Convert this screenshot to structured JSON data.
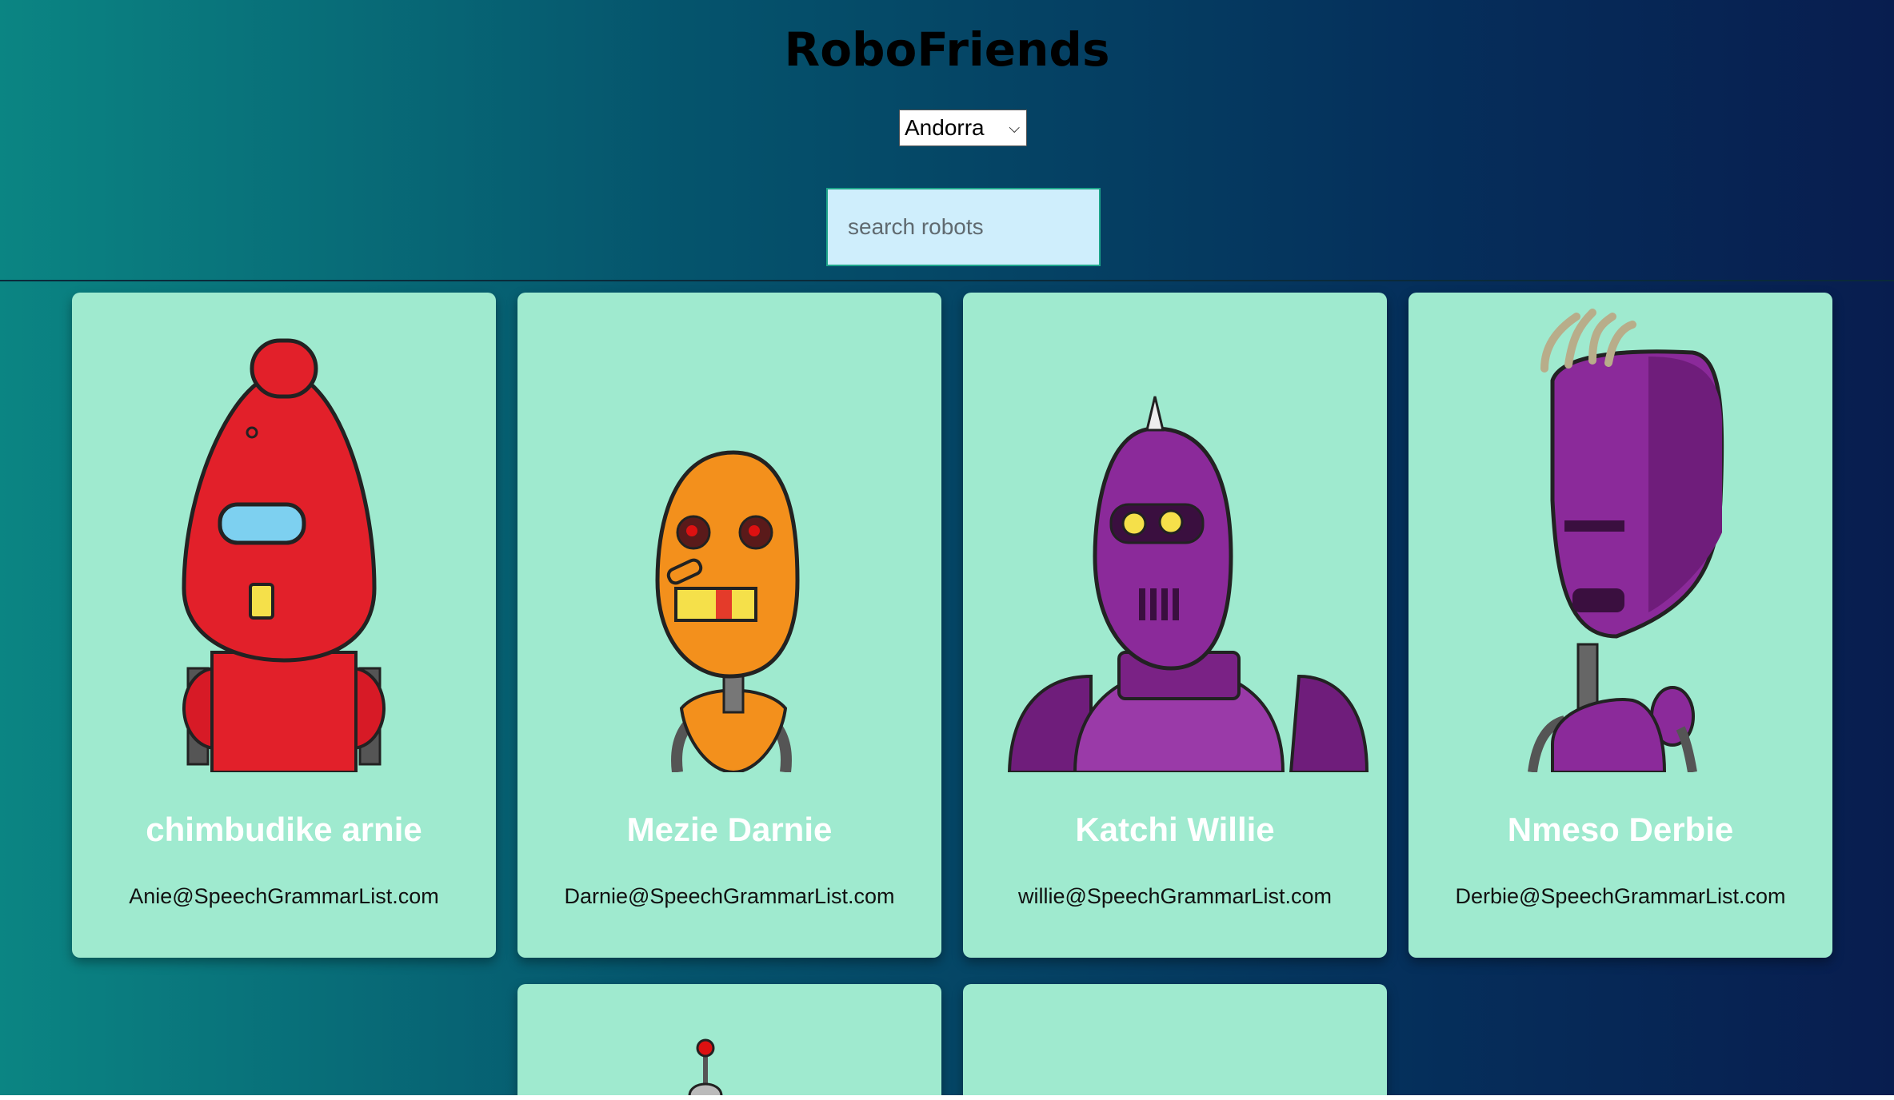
{
  "app": {
    "title": "RoboFriends"
  },
  "country_select": {
    "selected": "Andorra"
  },
  "search": {
    "placeholder": "search robots"
  },
  "robots": [
    {
      "name": "chimbudike arnie",
      "email": "Anie@SpeechGrammarList.com",
      "color": "#e2202a",
      "icon": "red-robot"
    },
    {
      "name": "Mezie Darnie",
      "email": "Darnie@SpeechGrammarList.com",
      "color": "#f3901c",
      "icon": "orange-robot"
    },
    {
      "name": "Katchi Willie",
      "email": "willie@SpeechGrammarList.com",
      "color": "#8b2a9a",
      "icon": "purple-robot"
    },
    {
      "name": "Nmeso Derbie",
      "email": "Derbie@SpeechGrammarList.com",
      "color": "#8b2a9a",
      "icon": "purple-robot"
    }
  ]
}
